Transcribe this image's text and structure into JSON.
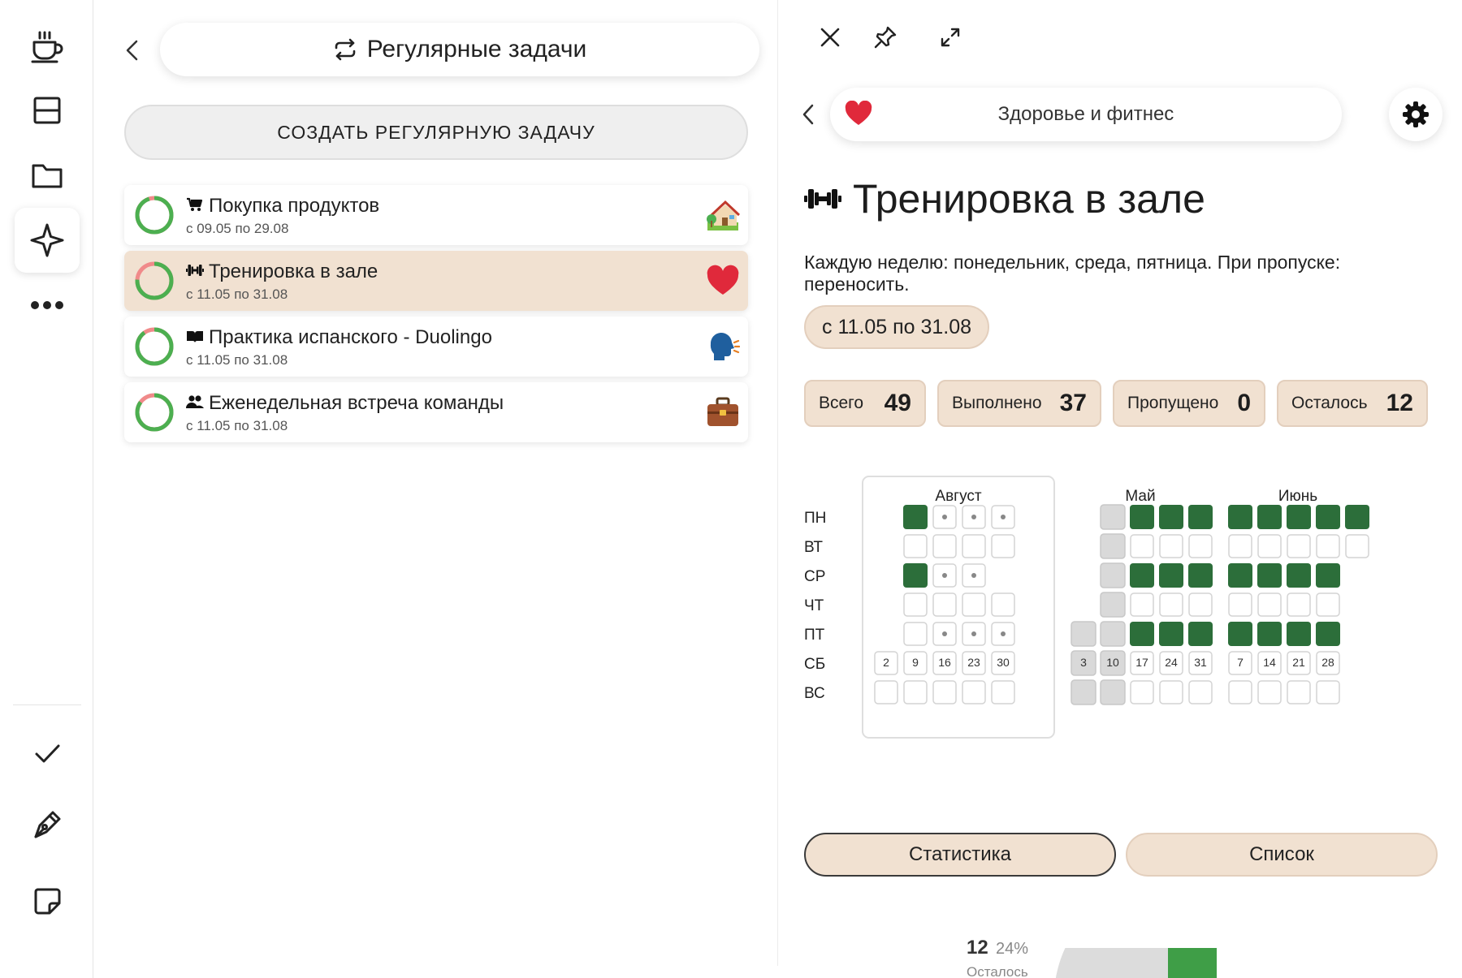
{
  "rail": {
    "items": [
      "coffee-icon",
      "layout-icon",
      "folder-icon",
      "sparkle-icon",
      "more-icon"
    ],
    "bottom_items": [
      "check-icon",
      "pen-icon",
      "sticker-icon"
    ]
  },
  "list_pane": {
    "title": "Регулярные задачи",
    "create_label": "СОЗДАТЬ РЕГУЛЯРНУЮ ЗАДАЧУ",
    "tasks": [
      {
        "name": "Покупка продуктов",
        "dates": "с 09.05 по 29.08",
        "icon": "cart-icon",
        "emoji": "house-emoji",
        "progress": 0.95
      },
      {
        "name": "Тренировка в зале",
        "dates": "с 11.05 по 31.08",
        "icon": "dumbbell-icon",
        "emoji": "heart-emoji",
        "progress": 0.76
      },
      {
        "name": "Практика испанского - Duolingo",
        "dates": "с 11.05 по 31.08",
        "icon": "book-icon",
        "emoji": "speaking-head-emoji",
        "progress": 0.9
      },
      {
        "name": "Еженедельная встреча команды",
        "dates": "с 11.05 по 31.08",
        "icon": "people-icon",
        "emoji": "briefcase-emoji",
        "progress": 0.85
      }
    ]
  },
  "detail": {
    "category": "Здоровье и фитнес",
    "title": "Тренировка в зале",
    "description": "Каждую неделю: понедельник, среда, пятница. При пропуске: переносить.",
    "date_range": "с 11.05 по 31.08",
    "stats": [
      {
        "label": "Всего",
        "value": "49"
      },
      {
        "label": "Выполнено",
        "value": "37"
      },
      {
        "label": "Пропущено",
        "value": "0"
      },
      {
        "label": "Осталось",
        "value": "12"
      }
    ],
    "weekdays": [
      "ПН",
      "ВТ",
      "СР",
      "ЧТ",
      "ПТ",
      "СБ",
      "ВС"
    ],
    "months": [
      {
        "name": "Август",
        "weeks": [
          "2",
          "9",
          "16",
          "23",
          "30"
        ]
      },
      {
        "name": "Май",
        "weeks": [
          "3",
          "10",
          "17",
          "24",
          "31"
        ]
      },
      {
        "name": "Июнь",
        "weeks": [
          "7",
          "14",
          "21",
          "28"
        ]
      }
    ],
    "stats_button": "Статистика",
    "list_button": "Список",
    "remaining": {
      "value": "12",
      "percent": "24%",
      "label": "Осталось"
    },
    "colors": {
      "done": "#2c6e3a",
      "planned_border": "#d4d4d4",
      "past": "#d9d9d9",
      "accent": "#f1e1d1",
      "pie_green": "#3f9e47"
    }
  }
}
